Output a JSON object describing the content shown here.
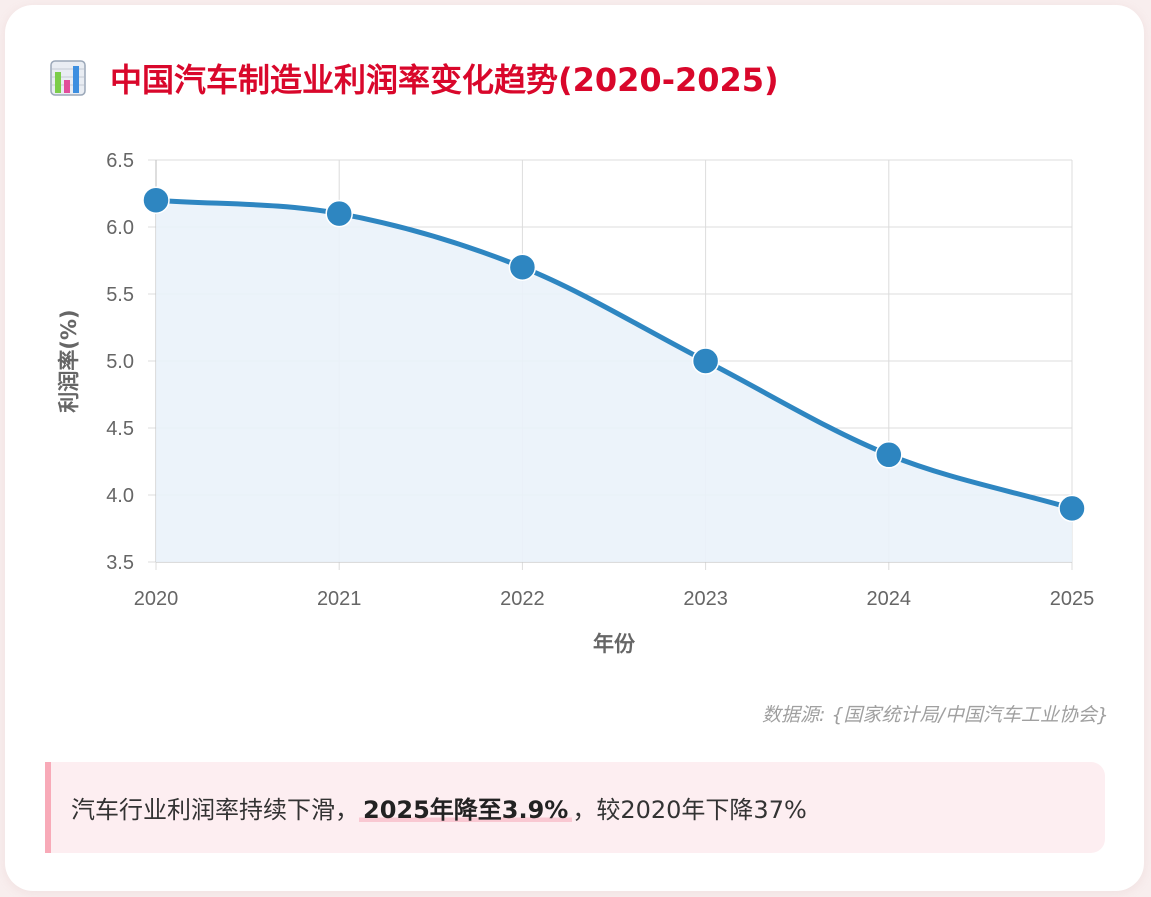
{
  "title": {
    "text": "中国汽车制造业利润率变化趋势(2020-2025)",
    "icon": "bar-chart-icon"
  },
  "chart_data": {
    "type": "line",
    "x": [
      "2020",
      "2021",
      "2022",
      "2023",
      "2024",
      "2025"
    ],
    "series": [
      {
        "values": [
          6.2,
          6.1,
          5.7,
          5.0,
          4.3,
          3.9
        ]
      }
    ],
    "ylabel": "利润率(%)",
    "xlabel": "年份",
    "ylim": [
      3.5,
      6.5
    ],
    "yticks": [
      "6.5",
      "6.0",
      "5.5",
      "5.0",
      "4.5",
      "4.0",
      "3.5"
    ],
    "grid": true,
    "smooth": true,
    "fill": true,
    "line_color": "#2e86c1",
    "fill_color": "#eaf2fa",
    "grid_color": "#dcdcdc"
  },
  "source": "数据源: {国家统计局/中国汽车工业协会}",
  "insight": {
    "prefix": "汽车行业利润率持续下滑，",
    "highlight": "2025年降至3.9%",
    "suffix": "，较2020年下降37%",
    "accent": "#f8aab8",
    "background": "#fdeef1"
  }
}
